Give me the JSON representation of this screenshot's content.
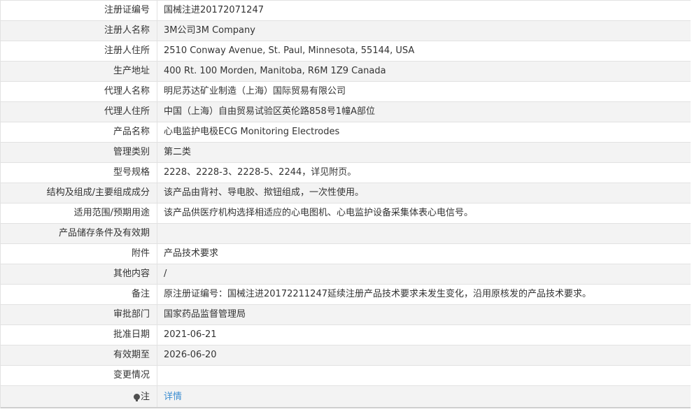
{
  "rows": [
    {
      "label": "注册证编号",
      "value": "国械注进20172071247"
    },
    {
      "label": "注册人名称",
      "value": "3M公司3M Company"
    },
    {
      "label": "注册人住所",
      "value": "2510 Conway Avenue, St. Paul, Minnesota, 55144, USA"
    },
    {
      "label": "生产地址",
      "value": "400 Rt. 100 Morden, Manitoba, R6M 1Z9 Canada"
    },
    {
      "label": "代理人名称",
      "value": "明尼苏达矿业制造（上海）国际贸易有限公司"
    },
    {
      "label": "代理人住所",
      "value": "中国（上海）自由贸易试验区英伦路858号1幢A部位"
    },
    {
      "label": "产品名称",
      "value": "心电监护电极ECG Monitoring Electrodes"
    },
    {
      "label": "管理类别",
      "value": "第二类"
    },
    {
      "label": "型号规格",
      "value": "2228、2228-3、2228-5、2244，详见附页。"
    },
    {
      "label": "结构及组成/主要组成成分",
      "value": "该产品由背衬、导电胶、揿钮组成，一次性使用。"
    },
    {
      "label": "适用范围/预期用途",
      "value": "该产品供医疗机构选择相适应的心电图机、心电监护设备采集体表心电信号。"
    },
    {
      "label": "产品储存条件及有效期",
      "value": ""
    },
    {
      "label": "附件",
      "value": "产品技术要求"
    },
    {
      "label": "其他内容",
      "value": "/"
    },
    {
      "label": "备注",
      "value": "原注册证编号：国械注进20172211247延续注册产品技术要求未发生变化，沿用原核发的产品技术要求。"
    },
    {
      "label": "审批部门",
      "value": "国家药品监督管理局"
    },
    {
      "label": "批准日期",
      "value": "2021-06-21"
    },
    {
      "label": "有效期至",
      "value": "2026-06-20"
    },
    {
      "label": "变更情况",
      "value": ""
    }
  ],
  "note": {
    "label": "注",
    "icon": "lightbulb-icon",
    "link_text": "详情",
    "link_color": "#3d8ed1"
  }
}
